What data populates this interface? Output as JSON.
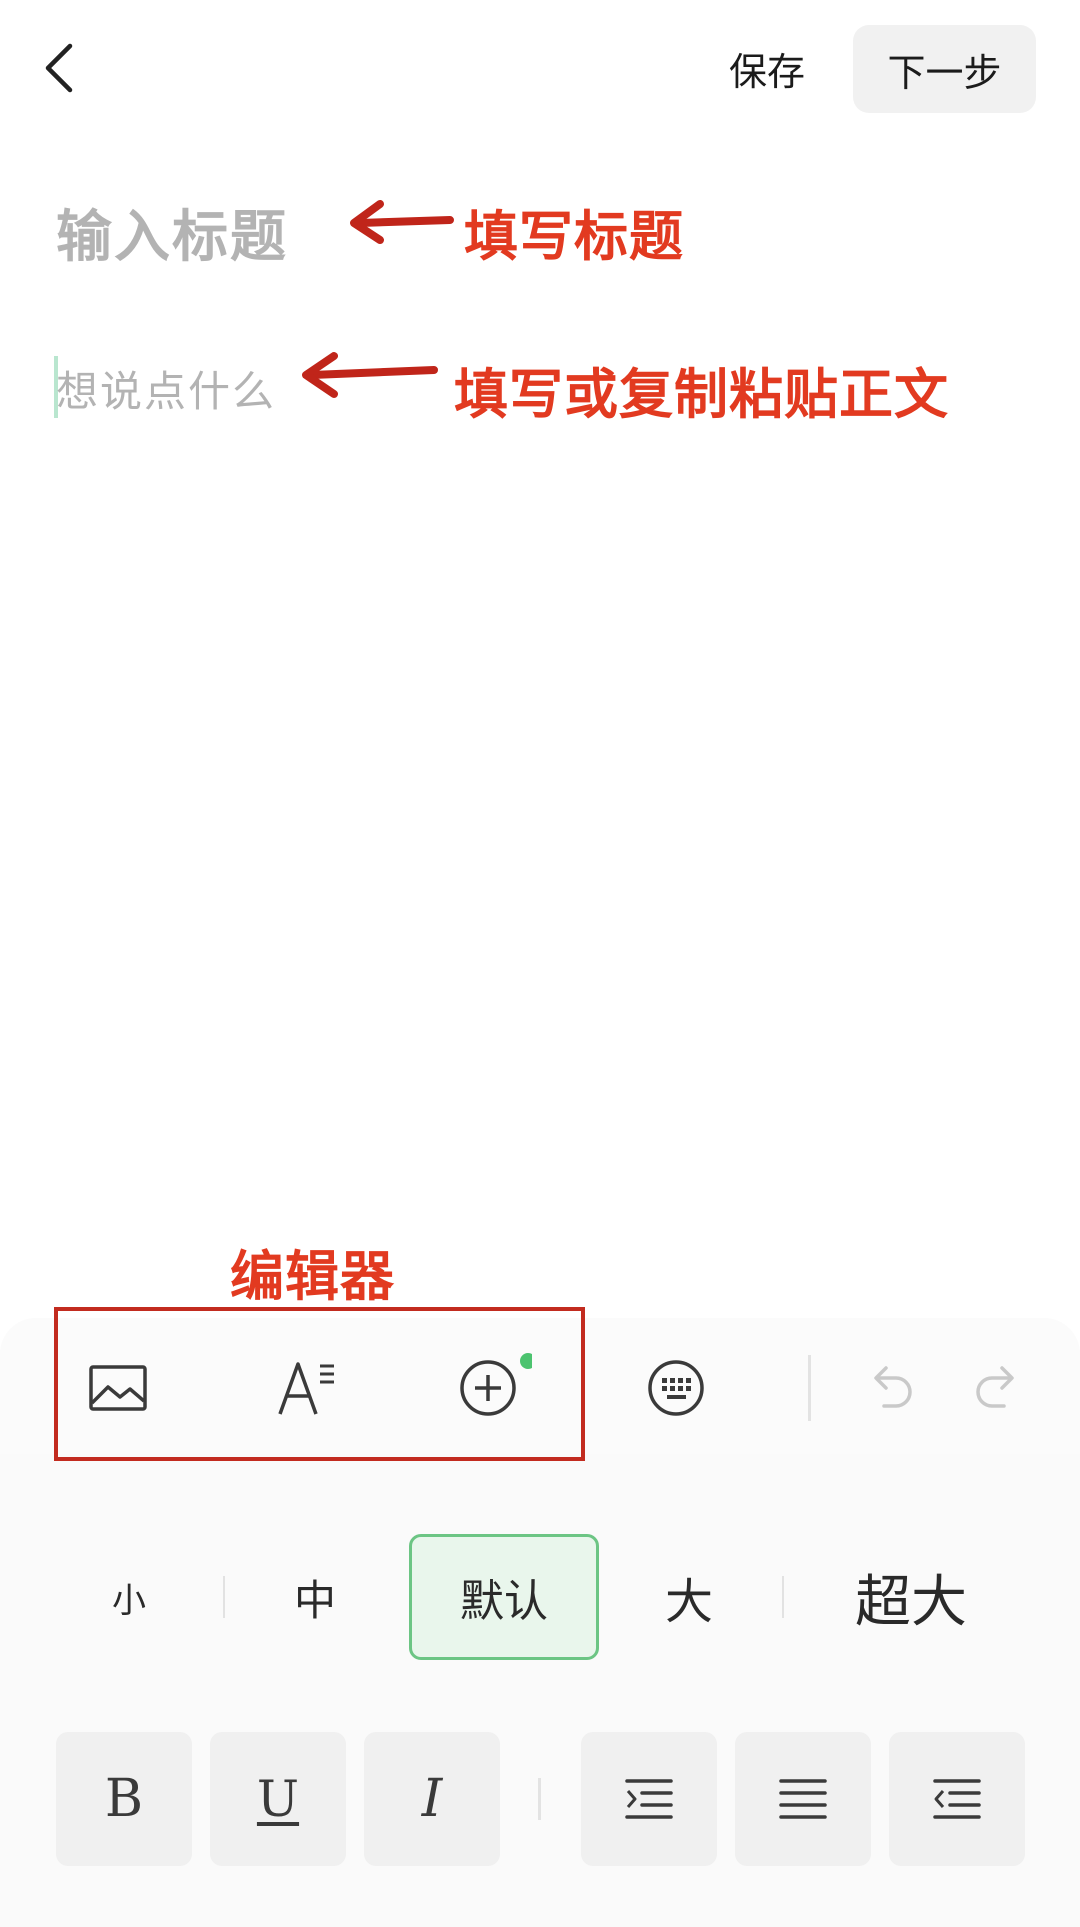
{
  "header": {
    "back_icon": "chevron-left-icon",
    "save_label": "保存",
    "next_label": "下一步"
  },
  "editor": {
    "title_placeholder": "输入标题",
    "body_placeholder": "想说点什么"
  },
  "annotations": {
    "title_hint": "填写标题",
    "body_hint": "填写或复制粘贴正文",
    "editor_label": "编辑器",
    "color": "#e23a20"
  },
  "toolbar": {
    "tools": [
      {
        "name": "image",
        "icon": "image-icon"
      },
      {
        "name": "text-style",
        "icon": "text-style-icon"
      },
      {
        "name": "add",
        "icon": "add-circle-icon",
        "badge": true
      },
      {
        "name": "keyboard",
        "icon": "keyboard-icon"
      },
      {
        "name": "undo",
        "icon": "undo-icon"
      },
      {
        "name": "redo",
        "icon": "redo-icon"
      }
    ],
    "badge_color": "#4cc36f"
  },
  "font_sizes": {
    "options": [
      "小",
      "中",
      "默认",
      "大",
      "超大"
    ],
    "selected": "默认"
  },
  "format": {
    "bold_label": "B",
    "underline_label": "U",
    "italic_label": "I",
    "align_icons": [
      "indent-icon",
      "align-justify-icon",
      "outdent-icon"
    ]
  }
}
